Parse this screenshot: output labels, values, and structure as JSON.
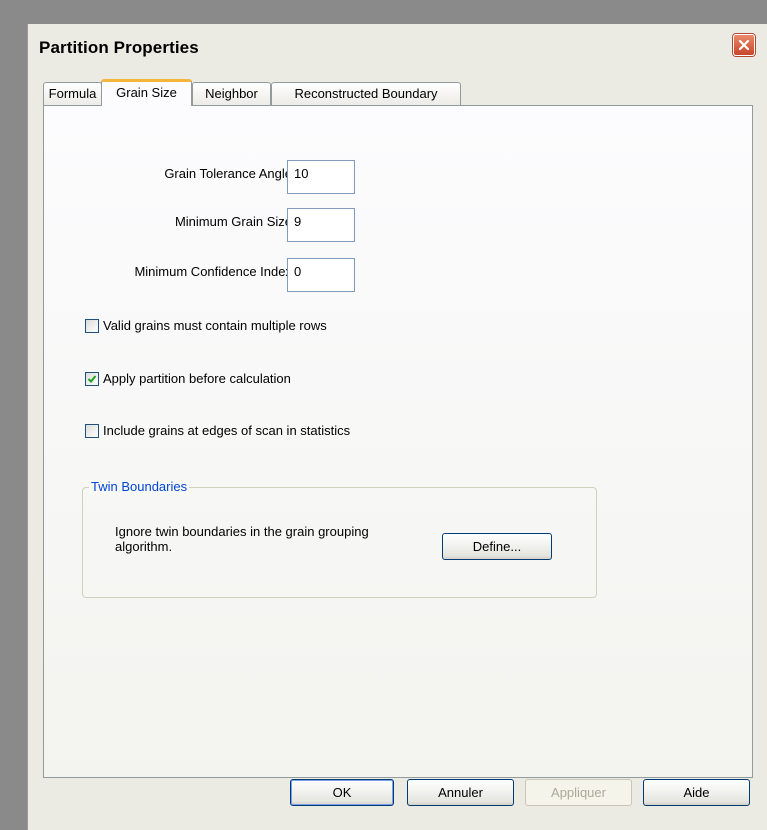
{
  "window": {
    "title": "Partition Properties",
    "close_icon": "close-icon"
  },
  "tabs": [
    {
      "label": "Formula",
      "active": false
    },
    {
      "label": "Grain Size",
      "active": true
    },
    {
      "label": "Neighbor",
      "active": false
    },
    {
      "label": "Reconstructed Boundary",
      "active": false
    }
  ],
  "fields": {
    "grain_tolerance_angle": {
      "label": "Grain Tolerance Angle",
      "value": "10"
    },
    "minimum_grain_size": {
      "label": "Minimum Grain Size",
      "value": "9"
    },
    "minimum_confidence_index": {
      "label": "Minimum Confidence Index",
      "value": "0"
    }
  },
  "checkboxes": [
    {
      "label": "Valid grains must contain multiple rows",
      "checked": false
    },
    {
      "label": "Apply partition before calculation",
      "checked": true
    },
    {
      "label": "Include grains at edges of scan in statistics",
      "checked": false
    }
  ],
  "twin_boundaries": {
    "legend": "Twin Boundaries",
    "description": "Ignore twin boundaries in the grain grouping algorithm.",
    "define_label": "Define..."
  },
  "buttons": {
    "ok": "OK",
    "cancel": "Annuler",
    "apply": "Appliquer",
    "help": "Aide"
  },
  "colors": {
    "tab_highlight": "#f5b43a",
    "close_button": "#c8462a",
    "group_legend": "#0046d5"
  }
}
